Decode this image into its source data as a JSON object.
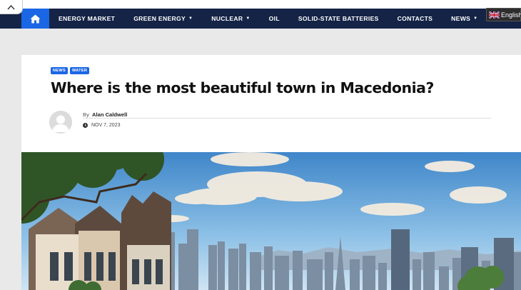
{
  "nav": {
    "items": [
      {
        "label": "ENERGY MARKET",
        "dropdown": false
      },
      {
        "label": "GREEN ENERGY",
        "dropdown": true
      },
      {
        "label": "NUCLEAR",
        "dropdown": true
      },
      {
        "label": "OIL",
        "dropdown": false
      },
      {
        "label": "SOLID-STATE BATTERIES",
        "dropdown": false
      },
      {
        "label": "CONTACTS",
        "dropdown": false
      },
      {
        "label": "NEWS",
        "dropdown": true
      }
    ],
    "home_icon": "home-icon",
    "caret_glyph": "▼"
  },
  "language": {
    "label": "English",
    "flag": "uk-flag-icon"
  },
  "article": {
    "tags": [
      "NEWS",
      "WATER"
    ],
    "title": "Where is the most beautiful town in Macedonia?",
    "author_prefix": "By",
    "author": "Alan Caldwell",
    "date": "NOV 7, 2023"
  },
  "colors": {
    "navbar": "#142346",
    "accent": "#1b66e4",
    "page_bg": "#e9e9e9"
  }
}
